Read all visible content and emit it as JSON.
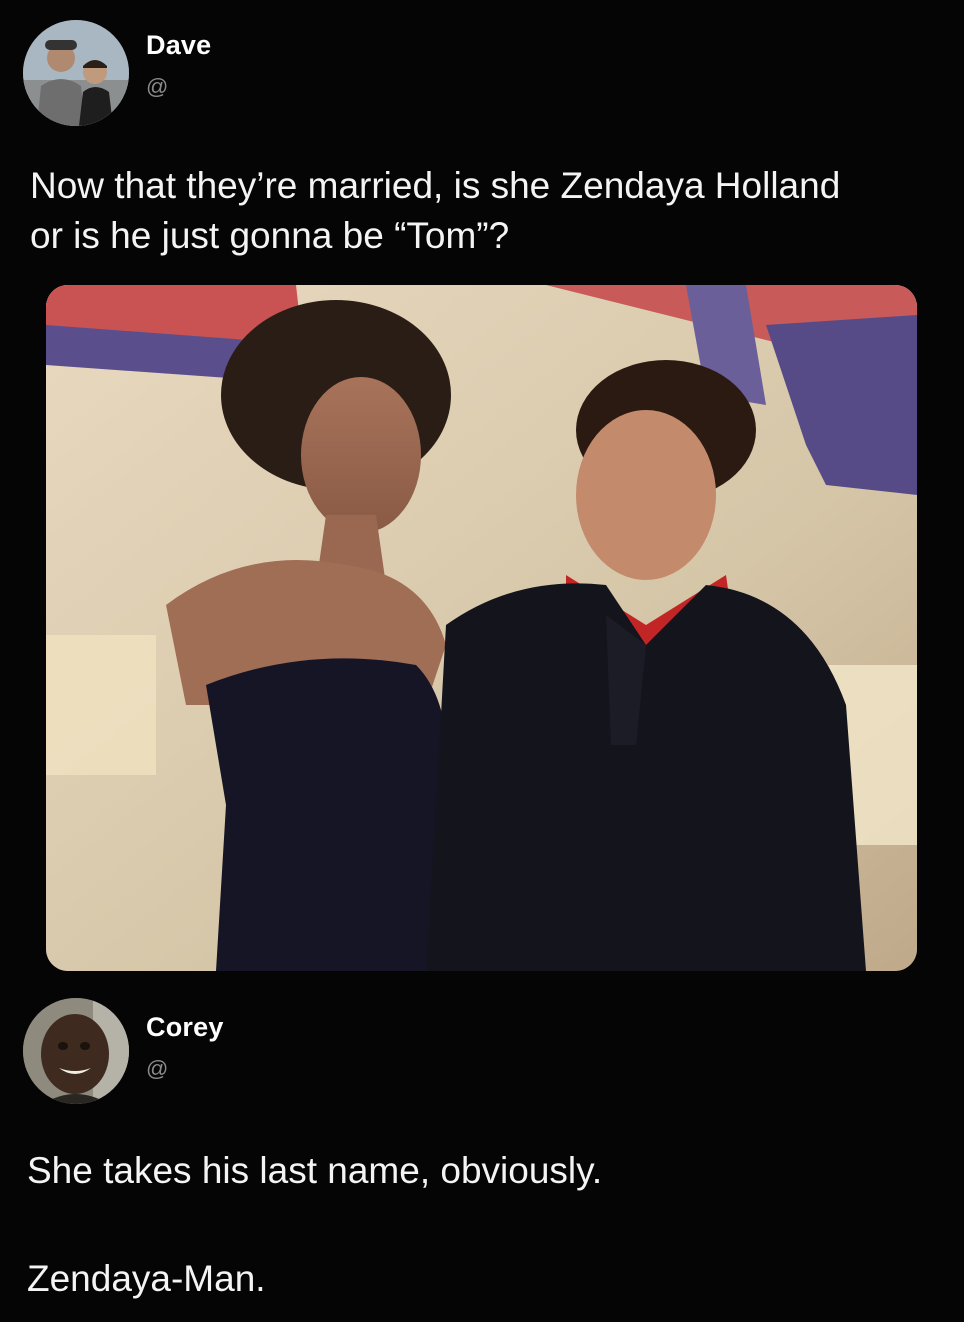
{
  "tweet": {
    "author_name": "Dave",
    "author_handle": "@",
    "text": "Now that they’re married, is she Zendaya Holland\nor is he just gonna be “Tom”?",
    "avatar_icon": "profile-photo-two-people",
    "media_icon": "photo-couple-red-carpet"
  },
  "reply": {
    "author_name": "Corey",
    "author_handle": "@",
    "text_line1": "She takes his last name, obviously.",
    "text_line2": "Zendaya-Man.",
    "avatar_icon": "profile-photo-smiling-man"
  },
  "colors": {
    "background": "#050505",
    "text": "#f4f4f4",
    "handle": "#8a8a8a"
  }
}
